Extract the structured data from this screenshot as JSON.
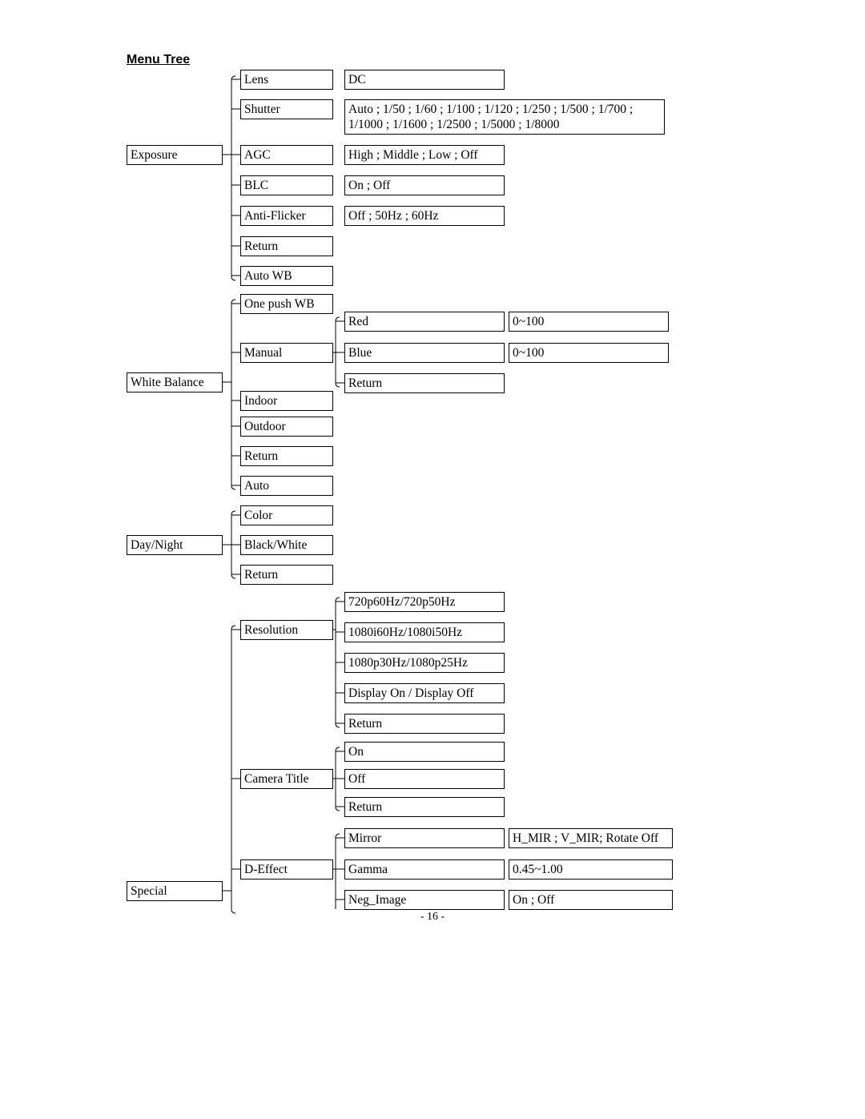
{
  "title": "Menu Tree",
  "page_number": "- 16 -",
  "col1": {
    "exposure": "Exposure",
    "white_balance": "White Balance",
    "day_night": "Day/Night",
    "special": "Special"
  },
  "col2": {
    "lens": "Lens",
    "shutter": "Shutter",
    "agc": "AGC",
    "blc": "BLC",
    "anti_flicker": "Anti-Flicker",
    "return1": "Return",
    "auto_wb": "Auto WB",
    "one_push_wb": "One push WB",
    "manual": "Manual",
    "indoor": "Indoor",
    "outdoor": "Outdoor",
    "return2": "Return",
    "auto": "Auto",
    "color": "Color",
    "black_white": "Black/White",
    "return3": "Return",
    "resolution": "Resolution",
    "camera_title": "Camera Title",
    "d_effect": "D-Effect"
  },
  "col3": {
    "dc": "DC",
    "shutter_vals": "Auto ; 1/50 ; 1/60 ; 1/100 ; 1/120 ; 1/250 ; 1/500 ; 1/700 ; 1/1000 ; 1/1600 ; 1/2500 ; 1/5000 ; 1/8000",
    "agc_vals": "High ; Middle ; Low ; Off",
    "blc_vals": "On ; Off",
    "anti_flicker_vals": "Off ; 50Hz ; 60Hz",
    "red": "Red",
    "blue": "Blue",
    "return1": "Return",
    "res1": "720p60Hz/720p50Hz",
    "res2": "1080i60Hz/1080i50Hz",
    "res3": "1080p30Hz/1080p25Hz",
    "res4": "Display On / Display Off",
    "return2": "Return",
    "ct_on": "On",
    "ct_off": "Off",
    "return3": "Return",
    "mirror": "Mirror",
    "gamma": "Gamma",
    "neg_image": "Neg_Image"
  },
  "col4": {
    "red_rng": "0~100",
    "blue_rng": "0~100",
    "mirror_vals": "H_MIR ; V_MIR; Rotate Off",
    "gamma_vals": "0.45~1.00",
    "neg_image_vals": "On ; Off"
  }
}
